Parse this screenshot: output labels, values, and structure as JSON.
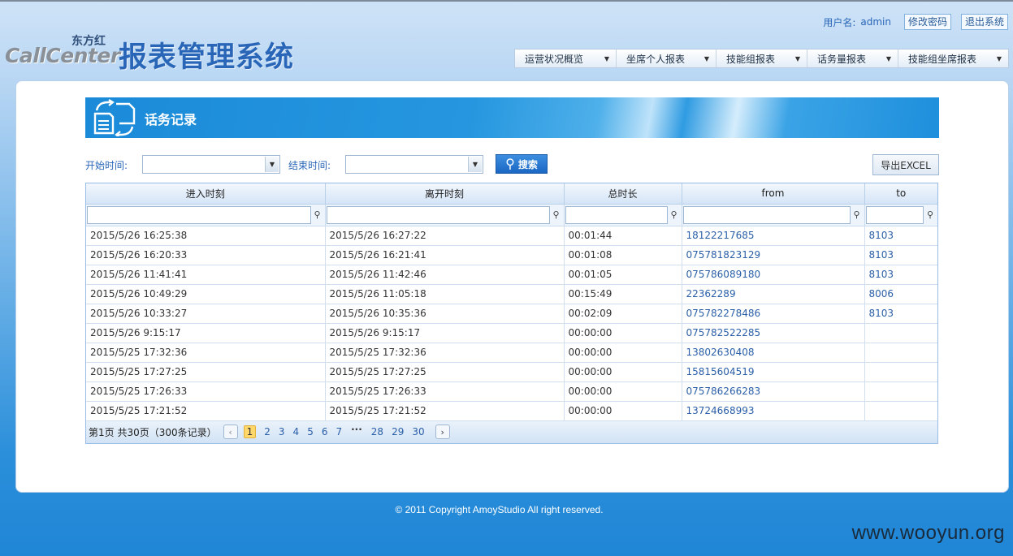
{
  "header": {
    "logo_small": "CallCenter",
    "logo_brand": "东方红",
    "logo_title": "报表管理系统",
    "user_label": "用户名:",
    "username": "admin",
    "change_password": "修改密码",
    "logout": "退出系统"
  },
  "nav": {
    "items": [
      {
        "label": "运营状况概览"
      },
      {
        "label": "坐席个人报表"
      },
      {
        "label": "技能组报表"
      },
      {
        "label": "话务量报表"
      },
      {
        "label": "技能组坐席报表"
      }
    ]
  },
  "page": {
    "title": "话务记录"
  },
  "search": {
    "start_label": "开始时间:",
    "start_value": "",
    "end_label": "结束时间:",
    "end_value": "",
    "search_button": "搜索",
    "export_button": "导出EXCEL"
  },
  "grid": {
    "columns": [
      "进入时刻",
      "离开时刻",
      "总时长",
      "from",
      "to"
    ],
    "rows": [
      [
        "2015/5/26 16:25:38",
        "2015/5/26 16:27:22",
        "00:01:44",
        "18122217685",
        "8103"
      ],
      [
        "2015/5/26 16:20:33",
        "2015/5/26 16:21:41",
        "00:01:08",
        "075781823129",
        "8103"
      ],
      [
        "2015/5/26 11:41:41",
        "2015/5/26 11:42:46",
        "00:01:05",
        "075786089180",
        "8103"
      ],
      [
        "2015/5/26 10:49:29",
        "2015/5/26 11:05:18",
        "00:15:49",
        "22362289",
        "8006"
      ],
      [
        "2015/5/26 10:33:27",
        "2015/5/26 10:35:36",
        "00:02:09",
        "075782278486",
        "8103"
      ],
      [
        "2015/5/26 9:15:17",
        "2015/5/26 9:15:17",
        "00:00:00",
        "075782522285",
        ""
      ],
      [
        "2015/5/25 17:32:36",
        "2015/5/25 17:32:36",
        "00:00:00",
        "13802630408",
        ""
      ],
      [
        "2015/5/25 17:27:25",
        "2015/5/25 17:27:25",
        "00:00:00",
        "15815604519",
        ""
      ],
      [
        "2015/5/25 17:26:33",
        "2015/5/25 17:26:33",
        "00:00:00",
        "075786266283",
        ""
      ],
      [
        "2015/5/25 17:21:52",
        "2015/5/25 17:21:52",
        "00:00:00",
        "13724668993",
        ""
      ]
    ]
  },
  "pager": {
    "info": "第1页 共30页（300条记录）",
    "prev": "‹",
    "next": "›",
    "pages": [
      "1",
      "2",
      "3",
      "4",
      "5",
      "6",
      "7"
    ],
    "ellipsis": "···",
    "last_pages": [
      "28",
      "29",
      "30"
    ],
    "current": "1"
  },
  "footer": {
    "copyright": "© 2011 Copyright AmoyStudio All right reserved."
  },
  "watermark": "www.wooyun.org"
}
